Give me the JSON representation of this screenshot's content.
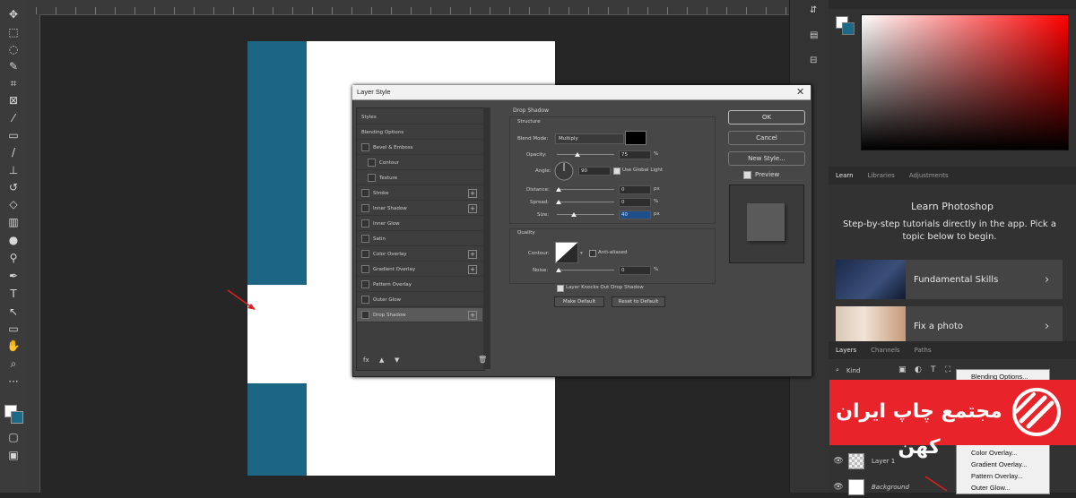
{
  "dialog": {
    "title": "Layer Style",
    "close": "✕",
    "styles": [
      {
        "label": "Styles",
        "checkbox": false,
        "plus": false,
        "indent": 0,
        "active": false
      },
      {
        "label": "Blending Options",
        "checkbox": false,
        "plus": false,
        "indent": 0,
        "active": false
      },
      {
        "label": "Bevel & Emboss",
        "checkbox": true,
        "plus": false,
        "indent": 0,
        "active": false
      },
      {
        "label": "Contour",
        "checkbox": true,
        "plus": false,
        "indent": 1,
        "active": false
      },
      {
        "label": "Texture",
        "checkbox": true,
        "plus": false,
        "indent": 1,
        "active": false
      },
      {
        "label": "Stroke",
        "checkbox": true,
        "plus": true,
        "indent": 0,
        "active": false
      },
      {
        "label": "Inner Shadow",
        "checkbox": true,
        "plus": true,
        "indent": 0,
        "active": false
      },
      {
        "label": "Inner Glow",
        "checkbox": true,
        "plus": false,
        "indent": 0,
        "active": false
      },
      {
        "label": "Satin",
        "checkbox": true,
        "plus": false,
        "indent": 0,
        "active": false
      },
      {
        "label": "Color Overlay",
        "checkbox": true,
        "plus": true,
        "indent": 0,
        "active": false
      },
      {
        "label": "Gradient Overlay",
        "checkbox": true,
        "plus": true,
        "indent": 0,
        "active": false
      },
      {
        "label": "Pattern Overlay",
        "checkbox": true,
        "plus": false,
        "indent": 0,
        "active": false
      },
      {
        "label": "Outer Glow",
        "checkbox": true,
        "plus": false,
        "indent": 0,
        "active": false
      },
      {
        "label": "Drop Shadow",
        "checkbox": true,
        "plus": true,
        "indent": 0,
        "active": true
      }
    ],
    "fx": {
      "fx_label": "fx"
    },
    "drop_shadow": {
      "section": "Drop Shadow",
      "structure": "Structure",
      "blend_mode_label": "Blend Mode:",
      "blend_mode_value": "Multiply",
      "opacity_label": "Opacity:",
      "opacity_value": "75",
      "angle_label": "Angle:",
      "angle_value": "90",
      "use_global_light": "Use Global Light",
      "distance_label": "Distance:",
      "distance_value": "0",
      "spread_label": "Spread:",
      "spread_value": "0",
      "size_label": "Size:",
      "size_value": "40",
      "unit_percent": "%",
      "unit_px": "px",
      "quality": "Quality",
      "contour_label": "Contour:",
      "anti_aliased": "Anti-aliased",
      "noise_label": "Noise:",
      "noise_value": "0",
      "knockout": "Layer Knocks Out Drop Shadow",
      "make_default": "Make Default",
      "reset_default": "Reset to Default",
      "shadow_color": "#000000"
    },
    "buttons": {
      "ok": "OK",
      "cancel": "Cancel",
      "new_style": "New Style...",
      "preview": "Preview"
    }
  },
  "learn": {
    "tabs": [
      "Learn",
      "Libraries",
      "Adjustments"
    ],
    "title": "Learn Photoshop",
    "subtitle": "Step-by-step tutorials directly in the app. Pick a topic below to begin.",
    "cards": [
      {
        "label": "Fundamental Skills",
        "chevron": "›"
      },
      {
        "label": "Fix a photo",
        "chevron": "›"
      }
    ]
  },
  "layers": {
    "tabs": [
      "Layers",
      "Channels",
      "Paths"
    ],
    "kind_label": "Kind",
    "rows": [
      {
        "name": "Layer 1",
        "eye": "👁"
      },
      {
        "name": "Background",
        "eye": "👁"
      }
    ]
  },
  "context_menu": {
    "items": [
      "Blending Options...",
      "Color Overlay...",
      "Gradient Overlay...",
      "Pattern Overlay...",
      "Outer Glow..."
    ]
  },
  "banner": {
    "text": "مجتمع چاپ ایران کهن",
    "color": "#e8242a"
  },
  "colors": {
    "teal": "#1c6683",
    "foreground": "#ffffff",
    "background_swatch": "#1d6a86"
  },
  "icons": {
    "tools": [
      "move-icon",
      "marquee-icon",
      "lasso-icon",
      "quick-select-icon",
      "crop-icon",
      "frame-icon",
      "eyedropper-icon",
      "healing-icon",
      "brush-icon",
      "stamp-icon",
      "history-brush-icon",
      "eraser-icon",
      "gradient-icon",
      "blur-icon",
      "dodge-icon",
      "pen-icon",
      "type-icon",
      "path-select-icon",
      "rectangle-icon",
      "hand-icon",
      "zoom-icon",
      "more-icon"
    ]
  }
}
